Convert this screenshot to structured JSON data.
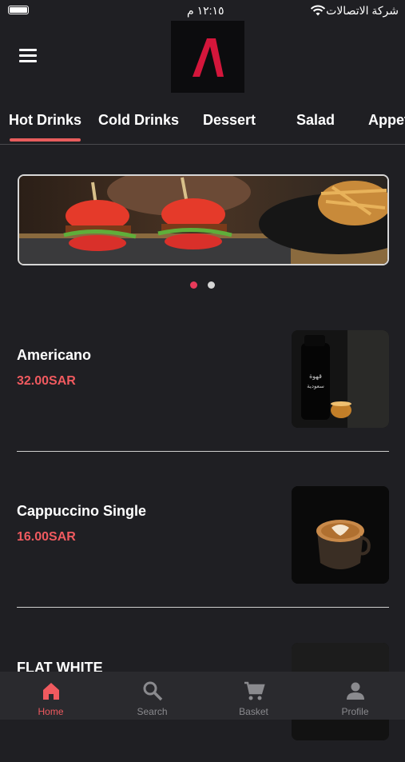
{
  "status_bar": {
    "time": "١٢:١٥ م",
    "carrier": "شركة الاتصالات"
  },
  "categories": [
    "Hot Drinks",
    "Cold Drinks",
    "Dessert",
    "Salad",
    "Appetizers"
  ],
  "products": [
    {
      "name": "Americano",
      "price": "32.00SAR",
      "image_icon": "coffee-bottle-image"
    },
    {
      "name": "Cappuccino Single",
      "price": "16.00SAR",
      "image_icon": "latte-art-cup-image"
    },
    {
      "name": "FLAT WHITE",
      "price": "",
      "image_icon": "coffee-image"
    }
  ],
  "banner": {
    "slides": 2,
    "active_slide": 1
  },
  "bottom_nav": [
    {
      "label": "Home",
      "icon": "home-icon",
      "active": true
    },
    {
      "label": "Search",
      "icon": "search-icon",
      "active": false
    },
    {
      "label": "Basket",
      "icon": "cart-icon",
      "active": false
    },
    {
      "label": "Profile",
      "icon": "profile-icon",
      "active": false
    }
  ],
  "colors": {
    "background": "#1f1f23",
    "accent": "#f05a5f",
    "nav_background": "#2a2a2e"
  }
}
